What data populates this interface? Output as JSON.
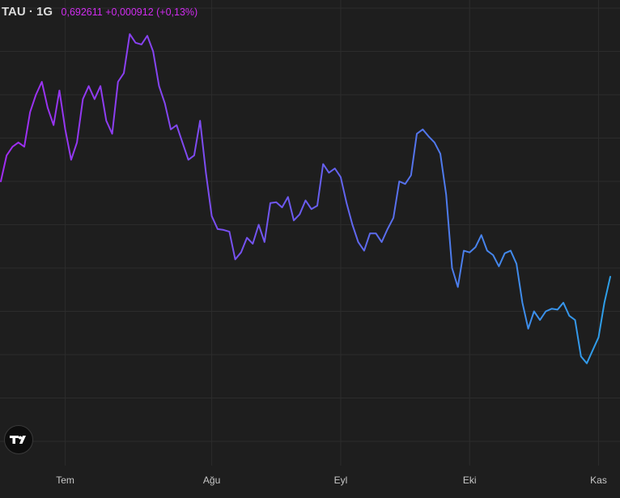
{
  "header": {
    "symbol": "TAU · 1G",
    "price": "0,692611",
    "change": "+0,000912",
    "change_pct": "(+0,13%)"
  },
  "colors": {
    "background": "#1e1e1e",
    "grid": "#2c2c2c",
    "header_values": "#d02cf0",
    "line_start": "#a12cf2",
    "line_mid": "#6a5cf0",
    "line_end": "#2d9fe8"
  },
  "chart_data": {
    "type": "line",
    "title": "TAU · 1G",
    "xlabel": "",
    "ylabel": "",
    "grid": true,
    "x_tick_labels": [
      {
        "label": "Tem",
        "index": 11
      },
      {
        "label": "Ağu",
        "index": 36
      },
      {
        "label": "Eyl",
        "index": 58
      },
      {
        "label": "Eki",
        "index": 80
      },
      {
        "label": "Kas",
        "index": 102
      }
    ],
    "ylim": [
      0.6,
      1.1
    ],
    "series": [
      {
        "values": [
          0.9,
          0.93,
          0.94,
          0.945,
          0.94,
          0.98,
          1.0,
          1.015,
          0.985,
          0.965,
          1.005,
          0.96,
          0.925,
          0.945,
          0.995,
          1.01,
          0.995,
          1.01,
          0.97,
          0.955,
          1.015,
          1.025,
          1.07,
          1.06,
          1.058,
          1.068,
          1.05,
          1.01,
          0.99,
          0.96,
          0.965,
          0.945,
          0.925,
          0.93,
          0.97,
          0.91,
          0.86,
          0.845,
          0.844,
          0.842,
          0.81,
          0.818,
          0.835,
          0.828,
          0.85,
          0.83,
          0.875,
          0.876,
          0.87,
          0.882,
          0.855,
          0.862,
          0.878,
          0.868,
          0.872,
          0.92,
          0.91,
          0.915,
          0.905,
          0.875,
          0.85,
          0.83,
          0.82,
          0.84,
          0.84,
          0.83,
          0.845,
          0.858,
          0.9,
          0.897,
          0.907,
          0.955,
          0.96,
          0.952,
          0.945,
          0.932,
          0.885,
          0.8,
          0.778,
          0.82,
          0.818,
          0.824,
          0.838,
          0.82,
          0.815,
          0.802,
          0.817,
          0.82,
          0.805,
          0.76,
          0.73,
          0.75,
          0.74,
          0.75,
          0.753,
          0.752,
          0.76,
          0.745,
          0.74,
          0.698,
          0.69,
          0.705,
          0.72,
          0.76,
          0.79
        ]
      }
    ]
  }
}
